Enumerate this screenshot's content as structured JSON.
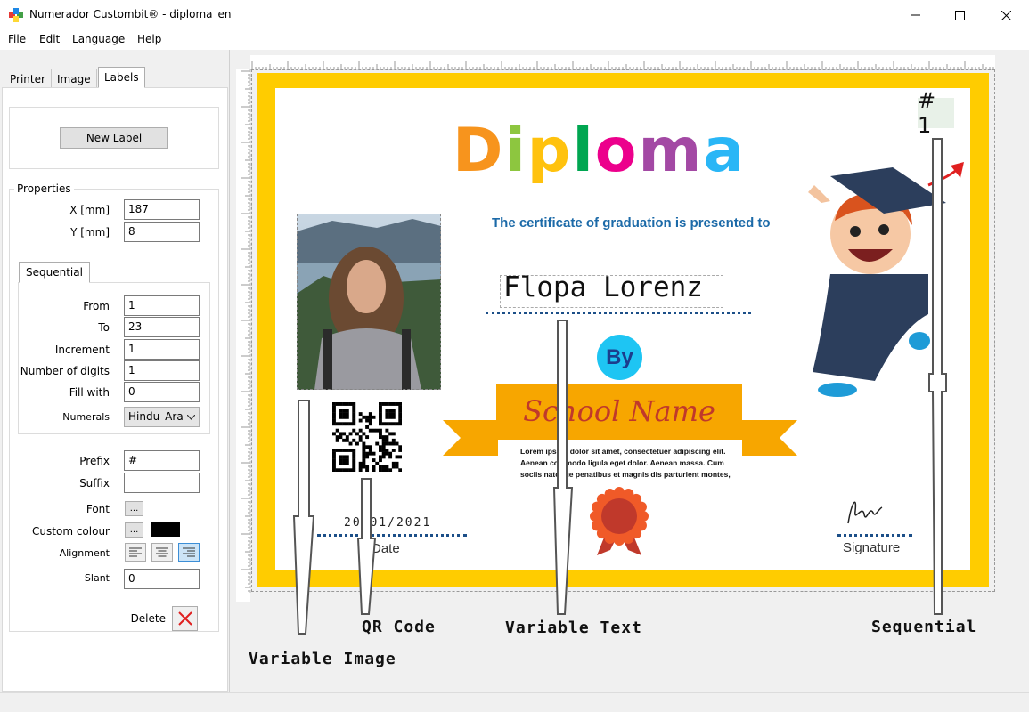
{
  "window": {
    "title": "Numerador Custombit® - diploma_en"
  },
  "menu": [
    {
      "label": "File",
      "underline": "F",
      "rest": "ile"
    },
    {
      "label": "Edit",
      "underline": "E",
      "rest": "dit"
    },
    {
      "label": "Language",
      "underline": "L",
      "rest": "anguage"
    },
    {
      "label": "Help",
      "underline": "H",
      "rest": "elp"
    }
  ],
  "tabs": [
    "Printer",
    "Image",
    "Labels"
  ],
  "labels_panel": {
    "new_label_button": "New Label",
    "properties_legend": "Properties",
    "x_label": "X [mm]",
    "x_value": "187",
    "y_label": "Y [mm]",
    "y_value": "8",
    "sequential_tab": "Sequential",
    "from_label": "From",
    "from_value": "1",
    "to_label": "To",
    "to_value": "23",
    "increment_label": "Increment",
    "increment_value": "1",
    "digits_label": "Number of digits",
    "digits_value": "1",
    "fill_label": "Fill with",
    "fill_value": "0",
    "numerals_label": "Numerals",
    "numerals_value": "Hindu–Ara",
    "prefix_label": "Prefix",
    "prefix_value": "#",
    "suffix_label": "Suffix",
    "suffix_value": "",
    "font_label": "Font",
    "font_button": "...",
    "colour_label": "Custom colour",
    "colour_button": "...",
    "colour_value": "#000000",
    "alignment_label": "Alignment",
    "slant_label": "Slant",
    "slant_value": "0",
    "delete_label": "Delete"
  },
  "diploma": {
    "sequential_text": "# 1",
    "title_letters": [
      {
        "ch": "D",
        "color": "#f7941d"
      },
      {
        "ch": "i",
        "color": "#8dc63f"
      },
      {
        "ch": "p",
        "color": "#ffc20e"
      },
      {
        "ch": "l",
        "color": "#00a651"
      },
      {
        "ch": "o",
        "color": "#ec008c"
      },
      {
        "ch": "m",
        "color": "#a349a4"
      },
      {
        "ch": "a",
        "color": "#29b6f6"
      }
    ],
    "subtitle": "The certificate of graduation is presented to",
    "name": "Flopa Lorenz",
    "by": "By",
    "school": "School Name",
    "lorem": [
      "Lorem ipsum dolor sit amet, consectetuer adipiscing elit.",
      "Aenean commodo ligula eget dolor. Aenean massa. Cum",
      "sociis natoque penatibus et magnis dis parturient montes,"
    ],
    "date": "20/01/2021",
    "date_label": "Date",
    "signature_label": "Signature",
    "frame_color": "#ffcc00"
  },
  "callouts": {
    "qr": "QR Code",
    "variable_text": "Variable Text",
    "sequential": "Sequential",
    "variable_image": "Variable Image"
  }
}
